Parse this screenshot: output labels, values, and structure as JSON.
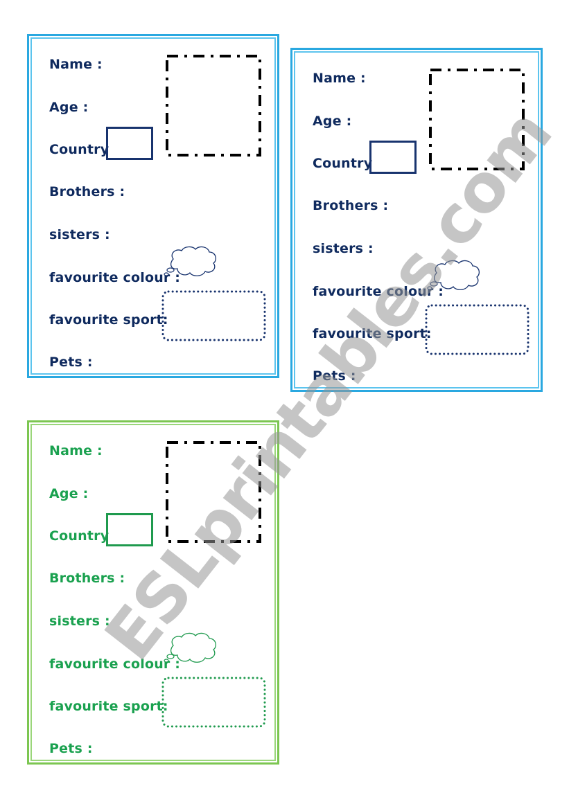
{
  "colors": {
    "blue_border": "#2aa8e0",
    "blue_text": "#0f2a5e",
    "green_border": "#7cc651",
    "green_text": "#1aa14f",
    "watermark": "#969696"
  },
  "cards": [
    {
      "theme": "blue",
      "fields": {
        "name": "Name :",
        "age": "Age :",
        "country": "Country",
        "brothers": "Brothers :",
        "sisters": "sisters :",
        "favourite_colour": "favourite colour :",
        "favourite_sport": "favourite sport:",
        "pets": "Pets :"
      }
    },
    {
      "theme": "blue",
      "fields": {
        "name": "Name :",
        "age": "Age :",
        "country": "Country",
        "brothers": "Brothers :",
        "sisters": "sisters :",
        "favourite_colour": "favourite colour :",
        "favourite_sport": "favourite sport:",
        "pets": "Pets :"
      }
    },
    {
      "theme": "green",
      "fields": {
        "name": "Name :",
        "age": "Age :",
        "country": "Country",
        "brothers": "Brothers :",
        "sisters": "sisters :",
        "favourite_colour": "favourite colour :",
        "favourite_sport": "favourite sport:",
        "pets": "Pets :"
      }
    }
  ],
  "watermark": "ESLprintables.com"
}
